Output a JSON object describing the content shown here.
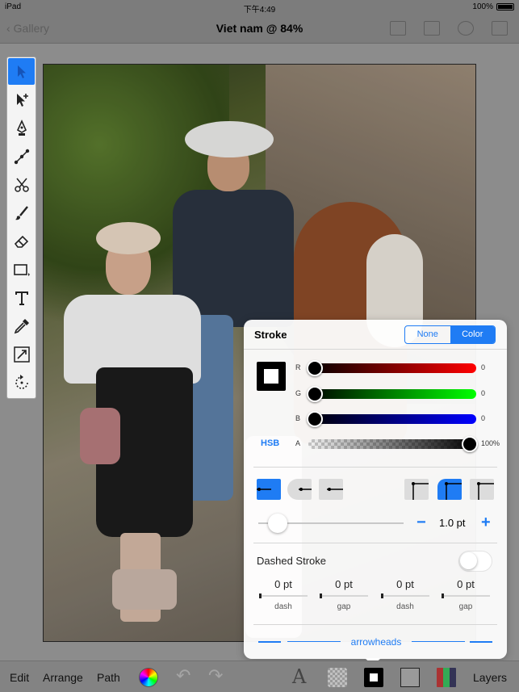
{
  "status_bar": {
    "device": "iPad",
    "time": "下午4:49",
    "battery": "100%"
  },
  "nav": {
    "back_label": "Gallery",
    "title": "Viet nam @ 84%"
  },
  "tools": [
    {
      "name": "select-tool"
    },
    {
      "name": "node-select-tool"
    },
    {
      "name": "pen-tool"
    },
    {
      "name": "bezier-tool"
    },
    {
      "name": "scissors-tool"
    },
    {
      "name": "brush-tool"
    },
    {
      "name": "eraser-tool"
    },
    {
      "name": "shape-tool"
    },
    {
      "name": "text-tool"
    },
    {
      "name": "eyedropper-tool"
    },
    {
      "name": "scale-tool"
    },
    {
      "name": "rotate-tool"
    }
  ],
  "stroke_panel": {
    "title": "Stroke",
    "mode_none": "None",
    "mode_color": "Color",
    "hsb_label": "HSB",
    "channels": [
      {
        "label": "R",
        "value": "0",
        "level": 0
      },
      {
        "label": "G",
        "value": "0",
        "level": 0
      },
      {
        "label": "B",
        "value": "0",
        "level": 0
      },
      {
        "label": "A",
        "value": "100%",
        "level": 1
      }
    ],
    "width_value": "1.0 pt",
    "width_minus": "−",
    "width_plus": "+",
    "dashed_label": "Dashed Stroke",
    "dashes": [
      {
        "value": "0 pt",
        "caption": "dash"
      },
      {
        "value": "0 pt",
        "caption": "gap"
      },
      {
        "value": "0 pt",
        "caption": "dash"
      },
      {
        "value": "0 pt",
        "caption": "gap"
      }
    ],
    "arrowheads_label": "arrowheads"
  },
  "bottom_bar": {
    "edit": "Edit",
    "arrange": "Arrange",
    "path": "Path",
    "layers": "Layers"
  },
  "colors": {
    "accent": "#1f7cf4",
    "toolbar_bg": "#f4f4f4"
  }
}
